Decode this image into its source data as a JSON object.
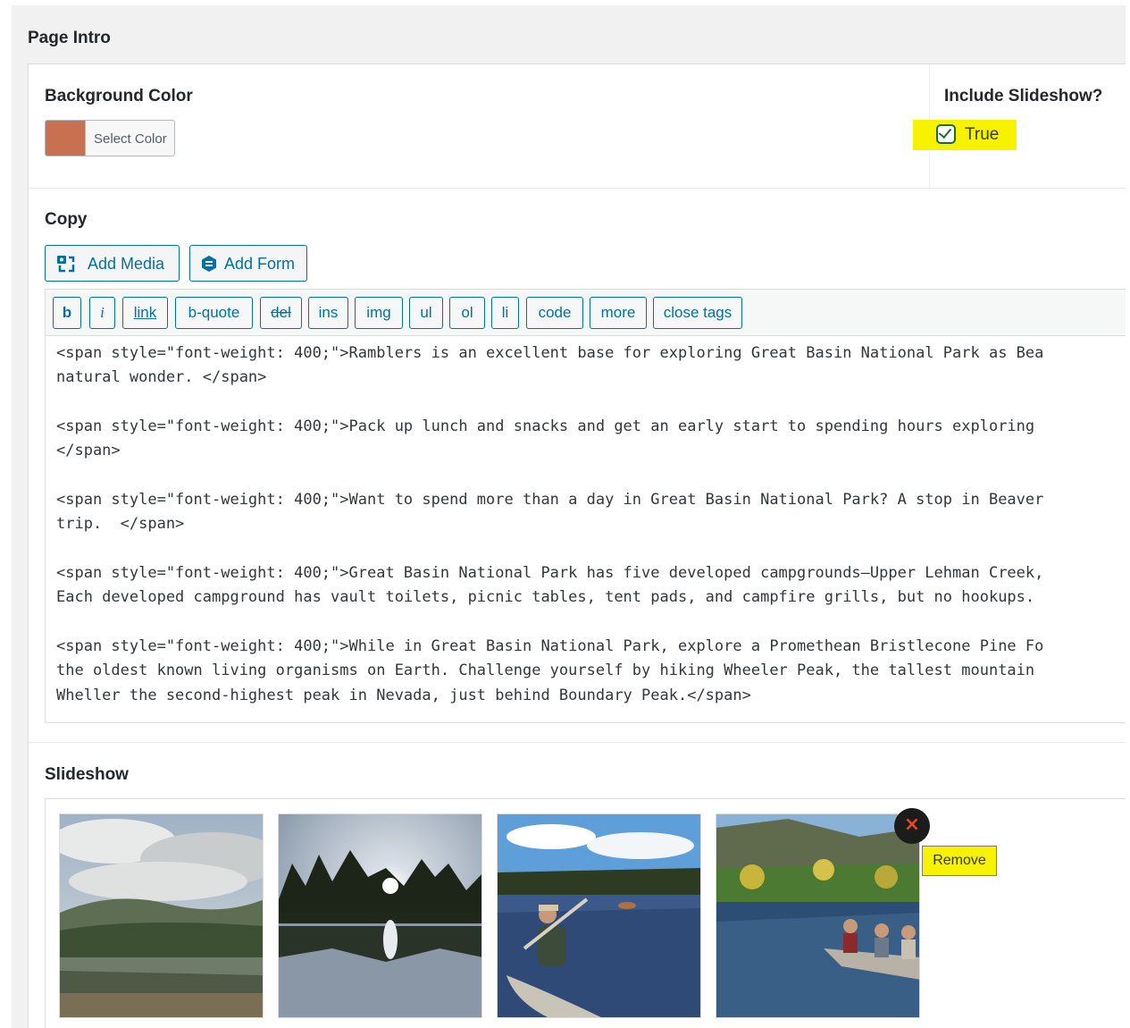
{
  "section_title": "Page Intro",
  "background_color": {
    "label": "Background Color",
    "button_label": "Select Color",
    "value": "#c8704f"
  },
  "slideshow_toggle": {
    "label": "Include Slideshow?",
    "checked": true,
    "option_label": "True",
    "highlight_color": "#f6f200"
  },
  "copy": {
    "label": "Copy",
    "media_buttons": [
      {
        "label": "Add Media",
        "icon": "media-icon"
      },
      {
        "label": "Add Form",
        "icon": "form-icon"
      }
    ],
    "quicktags": [
      "b",
      "i",
      "link",
      "b-quote",
      "del",
      "ins",
      "img",
      "ul",
      "ol",
      "li",
      "code",
      "more",
      "close tags"
    ],
    "content_lines": [
      "<span style=\"font-weight: 400;\">Ramblers is an excellent base for exploring Great Basin National Park as Bea",
      "natural wonder. </span>",
      "",
      "<span style=\"font-weight: 400;\">Pack up lunch and snacks and get an early start to spending hours exploring ",
      "</span>",
      "",
      "<span style=\"font-weight: 400;\">Want to spend more than a day in Great Basin National Park? A stop in Beaver",
      "trip.  </span>",
      "",
      "<span style=\"font-weight: 400;\">Great Basin National Park has five developed campgrounds—Upper Lehman Creek,",
      "Each developed campground has vault toilets, picnic tables, tent pads, and campfire grills, but no hookups. ",
      "",
      "<span style=\"font-weight: 400;\">While in Great Basin National Park, explore a Promethean Bristlecone Pine Fo",
      "the oldest known living organisms on Earth. Challenge yourself by hiking Wheeler Peak, the tallest mountain ",
      "Wheller the second-highest peak in Nevada, just behind Boundary Peak.</span>"
    ]
  },
  "slideshow": {
    "label": "Slideshow",
    "images": [
      {
        "name": "cloudy-lake-photo"
      },
      {
        "name": "sunset-lake-photo"
      },
      {
        "name": "canoe-paddler-photo"
      },
      {
        "name": "canoe-group-photo"
      }
    ],
    "remove_icon": "close-icon",
    "remove_glyph": "×",
    "remove_tooltip": "Remove",
    "tooltip_color": "#f6f200"
  }
}
